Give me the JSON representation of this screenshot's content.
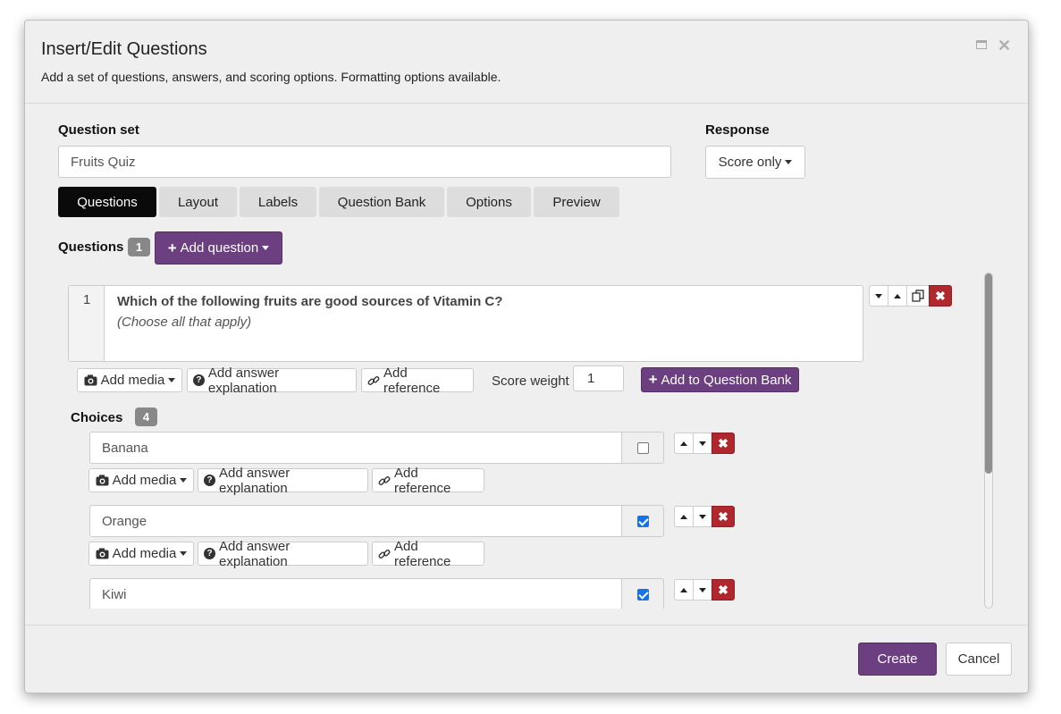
{
  "dialog": {
    "title": "Insert/Edit Questions",
    "subtitle": "Add a set of questions, answers, and scoring options. Formatting options available."
  },
  "question_set": {
    "label": "Question set",
    "value": "Fruits Quiz"
  },
  "response": {
    "label": "Response",
    "value": "Score only"
  },
  "tabs": [
    {
      "label": "Questions",
      "active": true
    },
    {
      "label": "Layout",
      "active": false
    },
    {
      "label": "Labels",
      "active": false
    },
    {
      "label": "Question Bank",
      "active": false
    },
    {
      "label": "Options",
      "active": false
    },
    {
      "label": "Preview",
      "active": false
    }
  ],
  "questions_header": {
    "label": "Questions",
    "count": "1",
    "add_label": "Add question"
  },
  "question": {
    "number": "1",
    "text": "Which of the following fruits are good sources of Vitamin C?",
    "hint": "(Choose all that apply)",
    "add_media": "Add media",
    "add_explanation": "Add answer explanation",
    "add_reference": "Add reference",
    "score_weight_label": "Score weight",
    "score_weight": "1",
    "add_to_bank": "Add to Question Bank"
  },
  "choices": {
    "label": "Choices",
    "count": "4",
    "items": [
      {
        "text": "Banana",
        "correct": false
      },
      {
        "text": "Orange",
        "correct": true
      },
      {
        "text": "Kiwi",
        "correct": true
      }
    ],
    "add_media": "Add media",
    "add_explanation": "Add answer explanation",
    "add_reference": "Add reference"
  },
  "footer": {
    "create_label": "Create",
    "cancel_label": "Cancel"
  },
  "colors": {
    "accent": "#6b3f80",
    "delete": "#b0272d",
    "active_tab": "#0a0a0a",
    "checkbox": "#1673e6"
  }
}
